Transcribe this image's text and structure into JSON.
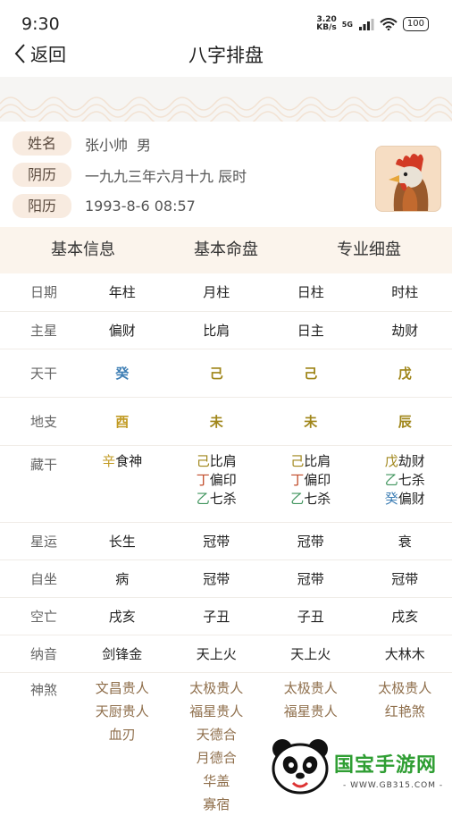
{
  "status": {
    "time": "9:30",
    "net_speed_value": "3.20",
    "net_speed_unit": "KB/s",
    "network": "5G",
    "battery": "100"
  },
  "nav": {
    "back_label": "返回",
    "title": "八字排盘"
  },
  "profile": {
    "name_label": "姓名",
    "name_value": "张小帅",
    "gender": "男",
    "lunar_label": "阴历",
    "lunar_value": "一九九三年六月十九 辰时",
    "solar_label": "阳历",
    "solar_value": "1993-8-6 08:57",
    "avatar_icon": "rooster-icon"
  },
  "tabs": [
    "基本信息",
    "基本命盘",
    "专业细盘"
  ],
  "chart": {
    "header_label": "日期",
    "columns": [
      "年柱",
      "月柱",
      "日柱",
      "时柱"
    ],
    "zhuxing_label": "主星",
    "zhuxing": [
      "偏财",
      "比肩",
      "日主",
      "劫财"
    ],
    "tiangan_label": "天干",
    "tiangan": [
      {
        "char": "癸",
        "color": "#3f7fb5"
      },
      {
        "char": "己",
        "color": "#a0861a"
      },
      {
        "char": "己",
        "color": "#a0861a"
      },
      {
        "char": "戊",
        "color": "#a0861a"
      }
    ],
    "dizhi_label": "地支",
    "dizhi": [
      {
        "char": "酉",
        "color": "#c19a22"
      },
      {
        "char": "未",
        "color": "#a0861a"
      },
      {
        "char": "未",
        "color": "#a0861a"
      },
      {
        "char": "辰",
        "color": "#a0861a"
      }
    ],
    "canggan_label": "藏干",
    "canggan": [
      [
        {
          "stem": "辛",
          "god": "食神"
        }
      ],
      [
        {
          "stem": "己",
          "god": "比肩"
        },
        {
          "stem": "丁",
          "god": "偏印"
        },
        {
          "stem": "乙",
          "god": "七杀"
        }
      ],
      [
        {
          "stem": "己",
          "god": "比肩"
        },
        {
          "stem": "丁",
          "god": "偏印"
        },
        {
          "stem": "乙",
          "god": "七杀"
        }
      ],
      [
        {
          "stem": "戊",
          "god": "劫财"
        },
        {
          "stem": "乙",
          "god": "七杀"
        },
        {
          "stem": "癸",
          "god": "偏财"
        }
      ]
    ],
    "xingyun_label": "星运",
    "xingyun": [
      "长生",
      "冠带",
      "冠带",
      "衰"
    ],
    "zizuo_label": "自坐",
    "zizuo": [
      "病",
      "冠带",
      "冠带",
      "冠带"
    ],
    "kongwang_label": "空亡",
    "kongwang": [
      "戌亥",
      "子丑",
      "子丑",
      "戌亥"
    ],
    "nayin_label": "纳音",
    "nayin": [
      "剑锋金",
      "天上火",
      "天上火",
      "大林木"
    ],
    "shensha_label": "神煞",
    "shensha": [
      [
        "文昌贵人",
        "天厨贵人",
        "血刃"
      ],
      [
        "太极贵人",
        "福星贵人",
        "天德合",
        "月德合",
        "华盖",
        "寡宿"
      ],
      [
        "太极贵人",
        "福星贵人"
      ],
      [
        "太极贵人",
        "红艳煞"
      ]
    ]
  },
  "watermark": {
    "title": "国宝手游网",
    "url": "- WWW.GB315.COM -"
  },
  "colors": {
    "tag_bg": "#f8ebe0",
    "tab_bg": "#fbf4ec",
    "header_text": "#a08a6e",
    "shui_blue": "#3f7fb5",
    "tu_olive": "#a0861a",
    "jin_gold": "#c19a22",
    "huo_red": "#c14b2a",
    "mu_green": "#41955e"
  }
}
